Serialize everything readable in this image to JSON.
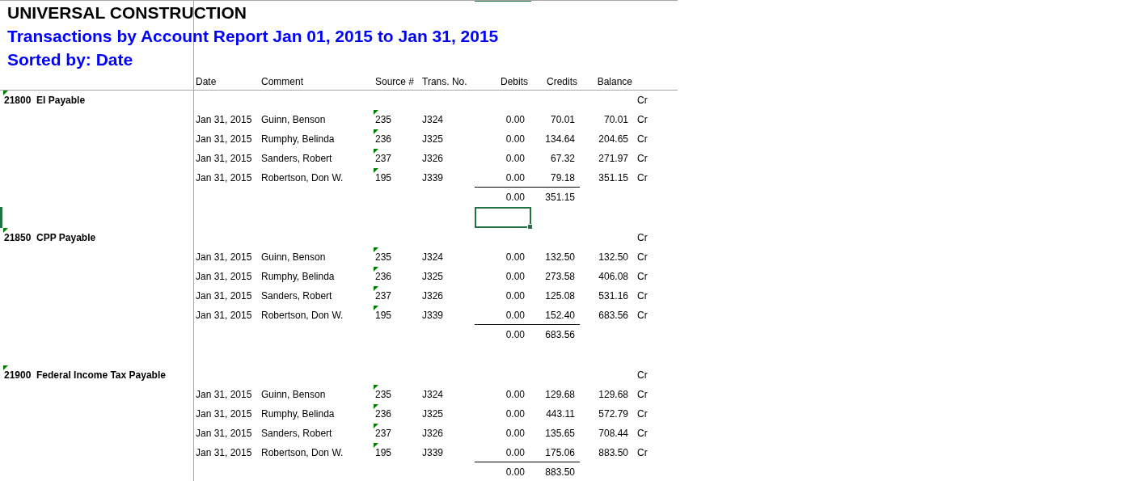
{
  "company": "UNIVERSAL CONSTRUCTION",
  "title": "Transactions by Account Report Jan 01, 2015 to Jan 31, 2015",
  "sort_line": "Sorted by: Date",
  "columns": [
    "Date",
    "Comment",
    "Source #",
    "Trans. No.",
    "Debits",
    "Credits",
    "Balance"
  ],
  "accounts": [
    {
      "label": "21800  EI Payable",
      "commented": true,
      "balance_type": "Cr",
      "total_debits": "0.00",
      "total_credits": "351.15",
      "spacer_selected": true,
      "transactions": [
        {
          "date": "Jan 31, 2015",
          "comment": "Guinn, Benson",
          "source": "235",
          "commented": true,
          "trans_no": "J324",
          "debit": "0.00",
          "credit": "70.01",
          "balance": "70.01",
          "balance_type": "Cr"
        },
        {
          "date": "Jan 31, 2015",
          "comment": "Rumphy, Belinda",
          "source": "236",
          "commented": true,
          "trans_no": "J325",
          "debit": "0.00",
          "credit": "134.64",
          "balance": "204.65",
          "balance_type": "Cr"
        },
        {
          "date": "Jan 31, 2015",
          "comment": "Sanders, Robert",
          "source": "237",
          "commented": true,
          "trans_no": "J326",
          "debit": "0.00",
          "credit": "67.32",
          "balance": "271.97",
          "balance_type": "Cr"
        },
        {
          "date": "Jan 31, 2015",
          "comment": "Robertson, Don W.",
          "source": "195",
          "commented": true,
          "trans_no": "J339",
          "debit": "0.00",
          "credit": "79.18",
          "balance": "351.15",
          "balance_type": "Cr"
        }
      ]
    },
    {
      "label": "21850  CPP Payable",
      "commented": true,
      "balance_type": "Cr",
      "total_debits": "0.00",
      "total_credits": "683.56",
      "spacer_selected": false,
      "transactions": [
        {
          "date": "Jan 31, 2015",
          "comment": "Guinn, Benson",
          "source": "235",
          "commented": true,
          "trans_no": "J324",
          "debit": "0.00",
          "credit": "132.50",
          "balance": "132.50",
          "balance_type": "Cr"
        },
        {
          "date": "Jan 31, 2015",
          "comment": "Rumphy, Belinda",
          "source": "236",
          "commented": true,
          "trans_no": "J325",
          "debit": "0.00",
          "credit": "273.58",
          "balance": "406.08",
          "balance_type": "Cr"
        },
        {
          "date": "Jan 31, 2015",
          "comment": "Sanders, Robert",
          "source": "237",
          "commented": true,
          "trans_no": "J326",
          "debit": "0.00",
          "credit": "125.08",
          "balance": "531.16",
          "balance_type": "Cr"
        },
        {
          "date": "Jan 31, 2015",
          "comment": "Robertson, Don W.",
          "source": "195",
          "commented": true,
          "trans_no": "J339",
          "debit": "0.00",
          "credit": "152.40",
          "balance": "683.56",
          "balance_type": "Cr"
        }
      ]
    },
    {
      "label": "21900  Federal Income Tax Payable",
      "commented": true,
      "balance_type": "Cr",
      "total_debits": "0.00",
      "total_credits": "883.50",
      "spacer_selected": false,
      "transactions": [
        {
          "date": "Jan 31, 2015",
          "comment": "Guinn, Benson",
          "source": "235",
          "commented": true,
          "trans_no": "J324",
          "debit": "0.00",
          "credit": "129.68",
          "balance": "129.68",
          "balance_type": "Cr"
        },
        {
          "date": "Jan 31, 2015",
          "comment": "Rumphy, Belinda",
          "source": "236",
          "commented": true,
          "trans_no": "J325",
          "debit": "0.00",
          "credit": "443.11",
          "balance": "572.79",
          "balance_type": "Cr"
        },
        {
          "date": "Jan 31, 2015",
          "comment": "Sanders, Robert",
          "source": "237",
          "commented": true,
          "trans_no": "J326",
          "debit": "0.00",
          "credit": "135.65",
          "balance": "708.44",
          "balance_type": "Cr"
        },
        {
          "date": "Jan 31, 2015",
          "comment": "Robertson, Don W.",
          "source": "195",
          "commented": true,
          "trans_no": "J339",
          "debit": "0.00",
          "credit": "175.06",
          "balance": "883.50",
          "balance_type": "Cr"
        }
      ]
    }
  ]
}
